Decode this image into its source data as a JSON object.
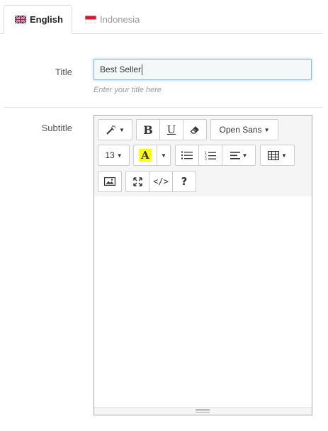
{
  "tabs": [
    {
      "label": "English",
      "flag": "uk-flag-icon",
      "active": true
    },
    {
      "label": "Indonesia",
      "flag": "indonesia-flag-icon",
      "active": false
    }
  ],
  "form": {
    "title_label": "Title",
    "title_value": "Best Seller",
    "title_help": "Enter your title here",
    "subtitle_label": "Subtitle"
  },
  "editor": {
    "toolbar": {
      "font_family": "Open Sans",
      "font_size": "13",
      "underline_glyph": "U",
      "bold_glyph": "B",
      "color_glyph": "A",
      "codeview_glyph": "</>",
      "help_glyph": "?"
    },
    "content": "",
    "highlight_color": "#ffff00",
    "accent_color": "#86b7e8"
  }
}
